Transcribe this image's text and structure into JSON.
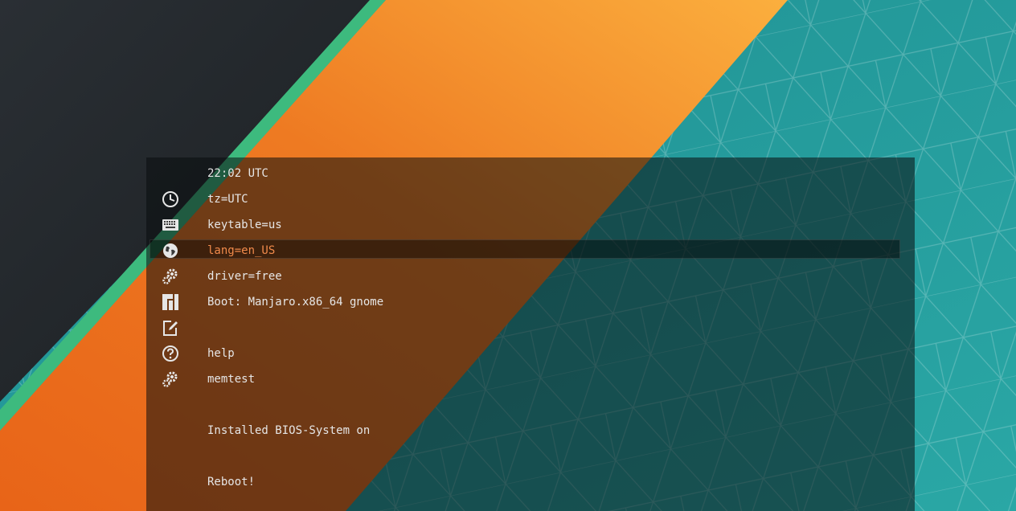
{
  "menu": {
    "time": "22:02 UTC",
    "timezone": "tz=UTC",
    "keytable": "keytable=us",
    "language": "lang=en_US",
    "driver": "driver=free",
    "boot": "Boot: Manjaro.x86_64 gnome",
    "edit": "",
    "help": "help",
    "memtest": "memtest",
    "installed": "Installed BIOS-System on",
    "reboot": "Reboot!"
  },
  "icons": {
    "timezone": "clock-icon",
    "keytable": "keyboard-icon",
    "language": "globe-icon",
    "driver": "gears-icon",
    "boot": "manjaro-logo-icon",
    "edit": "edit-icon",
    "help": "help-icon",
    "memtest": "gears-icon"
  },
  "colors": {
    "selected_text": "#f08a4b",
    "text": "#e6e6e6",
    "orange": "#f08a2a",
    "green": "#3dba7e",
    "teal": "#26a3a3",
    "dark": "#1e2226"
  }
}
